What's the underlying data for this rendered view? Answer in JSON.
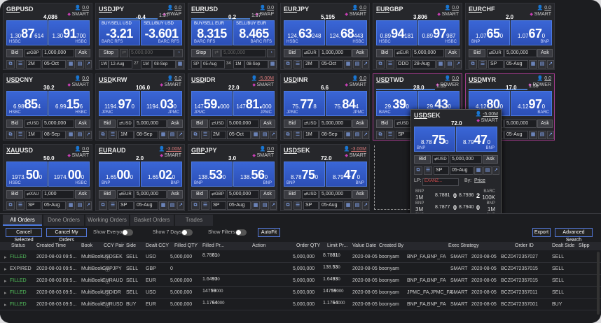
{
  "tiles": [
    {
      "base": "GBP",
      "quote": "USD",
      "qty": "0.0",
      "mode": "SMART",
      "spread": "4,086",
      "bid": {
        "s": "1.30",
        "b": "87",
        "t": "614",
        "bank": "HSBC"
      },
      "ask": {
        "s": "1.30",
        "b": "91",
        "t": "700",
        "bank": "HSBC"
      },
      "sel": "1,000,000",
      "ccy": "GBP",
      "date1": "2M",
      "date2": "05-Oct",
      "act": "Bid",
      "type": "std"
    },
    {
      "base": "USD",
      "quote": "JPY",
      "qty": "0.0",
      "mode": "SWAP",
      "spread": "-0.4",
      "timer": "1:37",
      "lblL": "BUY/SELL USD",
      "lblR": "SELL/BUY USD",
      "bid": {
        "s": "",
        "b": "-3.21",
        "t": "",
        "bank": "BARC RFS"
      },
      "ask": {
        "s": "",
        "b": "-3.601",
        "t": "",
        "bank": "BARC RFS"
      },
      "sel": "5,000,000",
      "ccy": "USD",
      "act": "Stop",
      "d1": "1W",
      "d2": "12-Aug",
      "d3": "27",
      "d4": "1M",
      "d5": "08-Sep",
      "type": "swap"
    },
    {
      "base": "EUR",
      "quote": "USD",
      "qty": "0.0",
      "mode": "SWAP",
      "spread": "0.2",
      "timer": "1:37",
      "lblL": "BUY/SELL EUR",
      "lblR": "SELL/BUY EUR",
      "bid": {
        "s": "",
        "b": "8.315",
        "t": "",
        "bank": "BARC RFS"
      },
      "ask": {
        "s": "",
        "b": "8.465",
        "t": "",
        "bank": "BARC RFS"
      },
      "sel": "5,000,000",
      "ccy": "EUR",
      "act": "Stop",
      "d1": "SP",
      "d2": "05-Aug",
      "d3": "34",
      "d4": "1M",
      "d5": "08-Sep",
      "type": "swap"
    },
    {
      "base": "EUR",
      "quote": "JPY",
      "qty": "0.0",
      "mode": "SMART",
      "spread": "5,195",
      "bid": {
        "s": "124.",
        "b": "63",
        "t": "248",
        "bank": "HSBC"
      },
      "ask": {
        "s": "124.",
        "b": "68",
        "t": "443",
        "bank": "HSBC"
      },
      "sel": "1,000,000",
      "ccy": "EUR",
      "date1": "2M",
      "date2": "05-Oct",
      "act": "Bid",
      "type": "std"
    },
    {
      "base": "EUR",
      "quote": "GBP",
      "qty": "0.0",
      "mode": "SMART",
      "spread": "3,806",
      "bid": {
        "s": "0.89",
        "b": "94",
        "t": "181",
        "bank": "HSBC"
      },
      "ask": {
        "s": "0.89",
        "b": "97",
        "t": "987",
        "bank": "HSBC"
      },
      "sel": "5,000,000",
      "ccy": "EUR",
      "date1": "ODD",
      "date2": "28-Aug",
      "act": "Bid",
      "type": "std"
    },
    {
      "base": "EUR",
      "quote": "CHF",
      "qty": "0.0",
      "mode": "SMART",
      "spread": "2.0",
      "bid": {
        "s": "1.07",
        "b": "65",
        "t": "0",
        "bank": "BNP"
      },
      "ask": {
        "s": "1.07",
        "b": "67",
        "t": "0",
        "bank": "BNP"
      },
      "sel": "5,000,000",
      "ccy": "EUR",
      "date1": "SP",
      "date2": "05-Aug",
      "act": "Bid",
      "type": "std"
    },
    {
      "base": "USD",
      "quote": "CNY",
      "qty": "0.0",
      "mode": "SMART",
      "spread": "30.2",
      "bid": {
        "s": "6.98",
        "b": "85",
        "t": "4",
        "bank": "HSBC"
      },
      "ask": {
        "s": "6.99",
        "b": "15",
        "t": "6",
        "bank": "HSBC"
      },
      "sel": "5,000,000",
      "ccy": "USD",
      "date1": "1M",
      "date2": "08-Sep",
      "act": "Bid",
      "type": "std"
    },
    {
      "base": "USD",
      "quote": "KRW",
      "qty": "0.0",
      "mode": "SMART",
      "spread": "106.0",
      "bid": {
        "s": "1194.",
        "b": "97",
        "t": "0",
        "bank": "JPMC"
      },
      "ask": {
        "s": "1194.",
        "b": "03",
        "t": "0",
        "bank": "JPMC"
      },
      "sel": "5,000,000",
      "ccy": "USD",
      "date1": "1M",
      "date2": "08-Sep",
      "act": "Bid",
      "type": "std"
    },
    {
      "base": "USD",
      "quote": "IDR",
      "qty": "-5.00M",
      "mode": "SMART",
      "spread": "22.0",
      "bid": {
        "s": "147",
        "b": "59.",
        "t": "000",
        "bank": "JPMC"
      },
      "ask": {
        "s": "147",
        "b": "81.",
        "t": "000",
        "bank": "JPMC"
      },
      "sel": "5,000,000",
      "ccy": "USD",
      "date1": "2M",
      "date2": "05-Oct",
      "act": "Bid",
      "type": "std",
      "neg": true
    },
    {
      "base": "USD",
      "quote": "INR",
      "qty": "0.0",
      "mode": "SMART",
      "spread": "6.6",
      "bid": {
        "s": "75.",
        "b": "77",
        "t": "8",
        "bank": "JPMC"
      },
      "ask": {
        "s": "75.",
        "b": "84",
        "t": "4",
        "bank": "JPMC"
      },
      "sel": "5,000,000",
      "ccy": "USD",
      "date1": "1M",
      "date2": "08-Sep",
      "act": "Bid",
      "type": "std"
    },
    {
      "base": "USD",
      "quote": "TWD",
      "qty": "0.0",
      "mode": "POWER",
      "spread": "28.0",
      "timer": "1:35",
      "bid": {
        "s": "29.",
        "b": "39",
        "t": "0",
        "bank": "BARC"
      },
      "ask": {
        "s": "29.",
        "b": "43",
        "t": "0",
        "bank": "BARC"
      },
      "sel": "5,000,000",
      "ccy": "USD",
      "date1": "SP",
      "date2": "05-Aug",
      "act": "Bid",
      "type": "power"
    },
    {
      "base": "USD",
      "quote": "MYR",
      "qty": "0.0",
      "mode": "POWER",
      "spread": "17.0",
      "timer": "1:36",
      "bid": {
        "s": "4.12",
        "b": "80",
        "t": "0",
        "bank": "BARC"
      },
      "ask": {
        "s": "4.12",
        "b": "97",
        "t": "0",
        "bank": "BARC"
      },
      "sel": "5,000,000",
      "ccy": "USD",
      "date1": "SP",
      "date2": "05-Aug",
      "act": "Bid",
      "type": "power"
    },
    {
      "base": "XAU",
      "quote": "USD",
      "qty": "0.0",
      "mode": "SMART",
      "spread": "50.0",
      "bid": {
        "s": "1973.",
        "b": "50",
        "t": "0",
        "bank": "HSBC"
      },
      "ask": {
        "s": "1974.",
        "b": "00",
        "t": "0",
        "bank": "HSBC"
      },
      "sel": "1,000",
      "ccy": "XAU",
      "date1": "SP",
      "date2": "05-Aug",
      "act": "Bid",
      "type": "std"
    },
    {
      "base": "EUR",
      "quote": "AUD",
      "qty": "-3.00M",
      "mode": "SMART",
      "spread": "2.0",
      "bid": {
        "s": "1.65",
        "b": "00",
        "t": "0",
        "bank": "BNP"
      },
      "ask": {
        "s": "1.65",
        "b": "02",
        "t": "0",
        "bank": "BNP"
      },
      "sel": "5,000,000",
      "ccy": "EUR",
      "date1": "SP",
      "date2": "05-Aug",
      "act": "Bid",
      "type": "std",
      "neg": true
    },
    {
      "base": "GBP",
      "quote": "JPY",
      "qty": "0.0",
      "mode": "SMART",
      "spread": "3.0",
      "bid": {
        "s": "138.",
        "b": "53",
        "t": "0",
        "bank": "BNP"
      },
      "ask": {
        "s": "138.",
        "b": "56",
        "t": "0",
        "bank": "BNP"
      },
      "sel": "5,000,000",
      "ccy": "GBP",
      "date1": "SP",
      "date2": "05-Aug",
      "act": "Bid",
      "type": "std"
    },
    {
      "base": "USD",
      "quote": "SEK",
      "qty": "-3.00M",
      "mode": "SMART",
      "spread": "72.0",
      "bid": {
        "s": "8.78",
        "b": "75",
        "t": "0",
        "bank": "BNP"
      },
      "ask": {
        "s": "8.79",
        "b": "47",
        "t": "0",
        "bank": "BNP"
      },
      "sel": "5,000,000",
      "ccy": "USD",
      "date1": "SP",
      "date2": "05-Aug",
      "act": "Bid",
      "type": "std",
      "neg": true
    }
  ],
  "popup": {
    "base": "USD",
    "quote": "SEK",
    "qty": "-5.00M",
    "mode": "SMART",
    "spread": "72.0",
    "bid": {
      "s": "8.78",
      "b": "75",
      "t": "0",
      "bank": "BNP"
    },
    "ask": {
      "s": "8.79",
      "b": "47",
      "t": "0",
      "bank": "BNP"
    },
    "sel": "5,000,000",
    "ccy": "USD",
    "date1": "SP",
    "date2": "05-Aug",
    "lp_label": "LP:",
    "lp_value": "EXANZ...",
    "by_label": "By:",
    "by_value": "Price",
    "ladder": [
      {
        "bank": "BNP",
        "size": "1M",
        "bid": "8.7881",
        "bidb": "0",
        "ask": "8.7936",
        "askb": "2",
        "abank": "BARC",
        "asize": "100K"
      },
      {
        "bank": "BNP",
        "size": "3M",
        "bid": "8.7877",
        "bidb": "0",
        "ask": "8.7940",
        "askb": "0",
        "abank": "BNP",
        "asize": "1M"
      },
      {
        "bank": "BNP",
        "size": "5M",
        "bid": "8.7875",
        "bidb": "0",
        "ask": "8.7944",
        "askb": "0",
        "abank": "BNP",
        "asize": "3M"
      },
      {
        "bank": "BNP",
        "size": "10M",
        "bid": "8.7873",
        "bidb": "0",
        "ask": "8.7947",
        "askb": "0",
        "abank": "BNP",
        "asize": "5M"
      },
      {
        "bank": "",
        "size": "0",
        "bid": "-",
        "bidb": "",
        "ask": "8.7951",
        "askb": "0",
        "abank": "BNP",
        "asize": "10M"
      }
    ]
  },
  "panel": {
    "tabs": [
      "All Orders",
      "Done Orders",
      "Working Orders",
      "Basket Orders",
      "Trades"
    ],
    "buttons": {
      "cancel_selected": "Cancel Selected",
      "cancel_my": "Cancel My Orders",
      "show_everyone": "Show Everyone",
      "show_7days": "Show 7 Days",
      "show_filters": "Show Filters",
      "autofit": "AutoFit",
      "export": "Export",
      "advanced": "Advanced Search"
    },
    "headers": [
      "Status",
      "Created Time",
      "Book",
      "CCY Pair",
      "Side",
      "Dealt CCY",
      "Filled QTY",
      "Filled Pr...",
      "Action",
      "Order QTY",
      "Limit Pr...",
      "Value Date",
      "Created By",
      "",
      "Exec Strategy",
      "",
      "Order ID",
      "Dealt Side",
      "Slipp"
    ],
    "rows": [
      {
        "status": "FILLED",
        "time": "2020-08-03 09:5...",
        "book": "MultiBook",
        "pair": "USDSEK",
        "side": "SELL",
        "ccy": "USD",
        "fqty": "5,000,000",
        "fpr_s": "8.78",
        "fpr_b": "81",
        "fpr_t": "0",
        "oqty": "5,000,000",
        "lpr_s": "8.78",
        "lpr_b": "81",
        "lpr_t": "0",
        "vdate": "2020-08-05",
        "by": "boonyam",
        "banks": "BNP_FA,BNP_FA",
        "strat": "SMART",
        "date2": "2020-08-05",
        "oid": "BCZ0472357027",
        "dside": "SELL"
      },
      {
        "status": "EXPIRED",
        "time": "2020-08-03 09:5...",
        "book": "MultiBook",
        "pair": "GBPJPY",
        "side": "SELL",
        "ccy": "GBP",
        "fqty": "0",
        "fpr_s": "",
        "fpr_b": "",
        "fpr_t": "",
        "oqty": "5,000,000",
        "lpr_s": "138.",
        "lpr_b": "53",
        "lpr_t": "0",
        "vdate": "2020-08-05",
        "by": "boonyam",
        "banks": "",
        "strat": "SMART",
        "date2": "2020-08-05",
        "oid": "BCZ0472357015",
        "dside": "SELL"
      },
      {
        "status": "FILLED",
        "time": "2020-08-03 09:5...",
        "book": "MultiBook",
        "pair": "EURAUD",
        "side": "SELL",
        "ccy": "EUR",
        "fqty": "5,000,000",
        "fpr_s": "1.64",
        "fpr_b": "93",
        "fpr_t": "0",
        "oqty": "5,000,000",
        "lpr_s": "1.64",
        "lpr_b": "93",
        "lpr_t": "0",
        "vdate": "2020-08-05",
        "by": "boonyam",
        "banks": "BNP_FA,BNP_FA",
        "strat": "SMART",
        "date2": "2020-08-05",
        "oid": "BCZ0472357015",
        "dside": "SELL"
      },
      {
        "status": "FILLED",
        "time": "2020-08-03 09:5...",
        "book": "MultiBook",
        "pair": "USDIDR",
        "side": "SELL",
        "ccy": "USD",
        "fqty": "5,000,000",
        "fpr_s": "147",
        "fpr_b": "59",
        "fpr_t": "000",
        "oqty": "5,000,000",
        "lpr_s": "147",
        "lpr_b": "59",
        "lpr_t": "000",
        "vdate": "2020-08-05",
        "by": "boonyam",
        "banks": "JPMC_FA,JPMC_FA",
        "strat": "SMART",
        "date2": "2020-08-05",
        "oid": "BCZ0472357011",
        "dside": "SELL"
      },
      {
        "status": "FILLED",
        "time": "2020-08-03 09:5...",
        "book": "MultiBook",
        "pair": "EURUSD",
        "side": "BUY",
        "ccy": "EUR",
        "fqty": "5,000,000",
        "fpr_s": "1.17",
        "fpr_b": "64",
        "fpr_t": "000",
        "oqty": "5,000,000",
        "lpr_s": "1.17",
        "lpr_b": "64",
        "lpr_t": "000",
        "vdate": "2020-08-05",
        "by": "boonyam",
        "banks": "BNP_FA,BNP_FA",
        "strat": "SMART",
        "date2": "2020-08-05",
        "oid": "BCZ0472357001",
        "dside": "BUY"
      }
    ]
  },
  "labels": {
    "bid": "Bid",
    "ask": "Ask",
    "stop": "Stop",
    "swap_qty": "5,000,000"
  }
}
